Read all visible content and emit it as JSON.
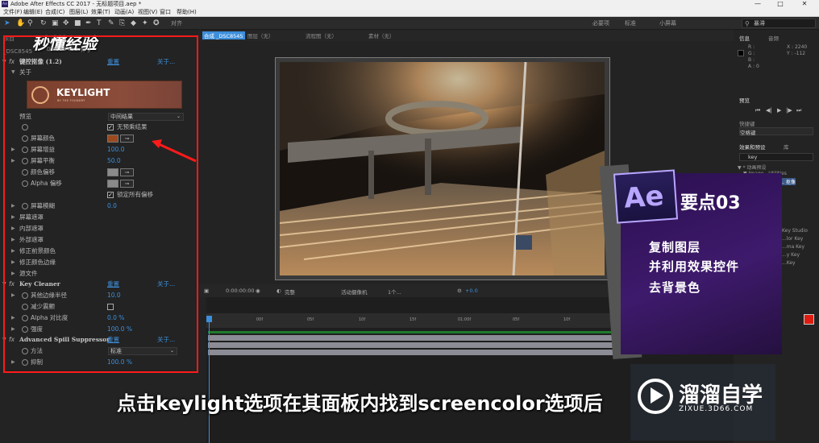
{
  "titlebar": {
    "app_icon": "Ae",
    "title": "Adobe After Effects CC 2017 - 无标题项目.aep *",
    "minimize": "—",
    "maximize": "□",
    "close": "✕"
  },
  "menu": [
    "文件(F)",
    "编辑(E)",
    "合成(C)",
    "图层(L)",
    "效果(T)",
    "动画(A)",
    "视图(V)",
    "窗口",
    "帮助(H)"
  ],
  "toolbar": {
    "workspaces": [
      "必要项",
      "标准",
      "小屏幕"
    ],
    "search_value": "暴滞",
    "snap_label": "对齐"
  },
  "left_panel": {
    "tab": "项目",
    "layer_name": "_DSC8545",
    "watermark": {
      "brand": "秒懂经验",
      "sub": "DSC85453.jpg"
    },
    "keylight": {
      "header": "键控抠像 (1.2)",
      "reset": "重置",
      "about": "关于...",
      "about_row": "关于",
      "banner_title": "KEYLIGHT",
      "banner_sub": "BY THE FOUNDRY",
      "view_label": "预览",
      "view_value": "中间结果",
      "unpremultiply": "无预乘结果",
      "screen_colour": "屏幕颜色",
      "screen_colour_hex": "#9b4a1f",
      "screen_gain": "屏幕增益",
      "screen_gain_val": "100.0",
      "screen_balance": "屏幕平衡",
      "screen_balance_val": "50.0",
      "despill_bias": "颜色偏移",
      "alpha_bias": "Alpha 偏移",
      "bias_swatch": "#8a8a8a",
      "lock_biases": "锁定所有偏移",
      "screen_preblur": "屏幕模糊",
      "screen_preblur_val": "0.0",
      "groups": [
        "屏幕遮罩",
        "内部遮罩",
        "外部遮罩",
        "修正前景颜色",
        "修正颜色边缘",
        "源文件"
      ]
    },
    "key_cleaner": {
      "header": "Key Cleaner",
      "reset": "重置",
      "about": "关于...",
      "rows": [
        {
          "label": "其他边缘半径",
          "value": "10.0"
        },
        {
          "label": "减少震颤",
          "value": ""
        },
        {
          "label": "Alpha 对比度",
          "value": "0.0 %"
        },
        {
          "label": "强度",
          "value": "100.0 %"
        }
      ]
    },
    "spill": {
      "header": "Advanced Spill Suppressor",
      "reset": "重置",
      "about": "关于...",
      "method_label": "方法",
      "method_value": "标准",
      "suppress_label": "抑制",
      "suppress_value": "100.0 %"
    }
  },
  "comp_tabs": [
    "合成 _DSC8545",
    "图层（无）",
    "流程图（无）",
    "素材（无）"
  ],
  "viewer_bar": {
    "zoom": "完整",
    "camera": "活动摄像机",
    "views": "1个...",
    "time": "0:00:00:00",
    "exposure": "+0.0"
  },
  "timeline": {
    "ticks": [
      "00f",
      "05f",
      "10f",
      "15f",
      "20f",
      "01:00f",
      "05f",
      "10f",
      "15f"
    ]
  },
  "right_panel": {
    "info_tab": "信息",
    "audio_tab": "音频",
    "info_lines": [
      "R :",
      "G :",
      "B :",
      "A : 0"
    ],
    "coords": [
      "X : 2240",
      "Y : -112"
    ],
    "preview_tab": "预览",
    "shortcut_label": "快捷键",
    "shortcut_value": "空格键",
    "effects_tab": "效果和预设",
    "library_tab": "库",
    "search": "key",
    "tree": [
      "▼ * 动画预设",
      "▼ Image - Utilities",
      "Keylight+... 抠像",
      "Key Studio",
      "...lor Key",
      "...ma Key",
      "...y Key",
      "...Key",
      "...Key"
    ]
  },
  "promo": {
    "logo": "Ae",
    "title": "要点03",
    "lines": [
      "复制图层",
      "并利用效果控件",
      "去背景色"
    ]
  },
  "subtitle": "点击keylight选项在其面板内找到screencolor选项后",
  "watermark_right": {
    "name": "溜溜自学",
    "url": "ZIXUE.3D66.COM"
  }
}
